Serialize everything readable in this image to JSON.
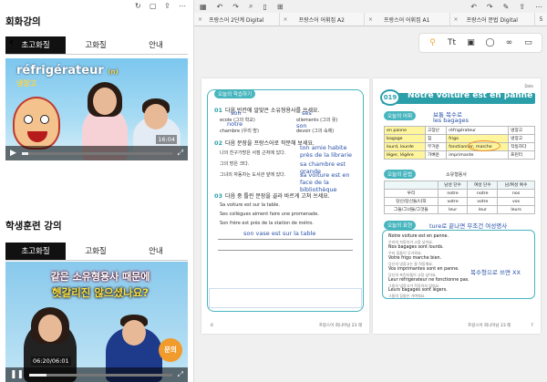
{
  "left": {
    "section1_title": "회화강의",
    "section2_title": "학생훈련 강의",
    "tabs1": [
      "초고화질",
      "고화질",
      "안내"
    ],
    "tabs2": [
      "초고화질",
      "고화질",
      "안내"
    ],
    "video1": {
      "word": "réfrigérateur",
      "word_suffix": "(n)",
      "subtitle": "냉장고",
      "time": "16:04",
      "progress": 0.04
    },
    "video2": {
      "line1": "같은 소유형용사 때문에",
      "line2": "헷갈리진 않으셨나요?",
      "time": "06:20/06:01",
      "progress": 0.12,
      "badge": "문의"
    }
  },
  "right": {
    "doc_tabs": [
      "프랑스어 2단계 Digital",
      "프랑스어 어휘집 A2",
      "프랑스어 어휘집 A1",
      "프랑스어 문법 Digital"
    ],
    "doc_tab_num": "5",
    "left_page": {
      "header_pill": "오늘의 학습하기",
      "q1": "다음 빈칸에 알맞은 소유형용사를 쓰세요.",
      "q1_items": [
        "ecole (그의 학교)",
        "ollements (그의 옷)",
        "chambre (우리 방)",
        "devoir (그의 숙제)"
      ],
      "q1_hand": [
        "son",
        "ses",
        "notre",
        "son"
      ],
      "q2": "다음 문장을 프랑스어로 작문해 보세요.",
      "q2_items": [
        "나의 친구가방은 서점 근처에 있다.",
        "그의 방은 크다.",
        "그녀의 자동차는 도서관 앞에 있다."
      ],
      "q2_hand": [
        "ton amie habite près de la librarie",
        "sa chambre est grande",
        "sa voiture est en face de la bibliothèque"
      ],
      "q3": "다음 중 틀린 문장을 골라 바르게 고쳐 쓰세요.",
      "q3_items": [
        "Sa voiture est sur la table.",
        "Ses collègues aiment faire une promenade.",
        "Son frère est près de la station de métro."
      ],
      "q3_hand": "son vase est sur la table",
      "footer_left": "6",
      "footer_right": "프랑스어 회니어님 23 레"
    },
    "right_page": {
      "date_label": "Date",
      "lesson_num": "019",
      "title": "Notre voiture est en panne",
      "vocab_pill": "오늘의 어휘",
      "vocab_note1": "보통 복수로",
      "vocab_note2": "les bagages",
      "vocab_rows": [
        [
          "en panne",
          "고장난",
          "réfrigérateur",
          "냉장고"
        ],
        [
          "bagage",
          "짐",
          "frigo",
          "냉장고"
        ],
        [
          "lourd, lourde",
          "무거운",
          "fonctionner, marche",
          "작동하다"
        ],
        [
          "léger, légère",
          "가벼운",
          "imprimante",
          "프린터"
        ]
      ],
      "grammar_pill": "오늘의 문법",
      "grammar_sub": "소유형용사",
      "grammar_headers": [
        "",
        "남성 단수",
        "여성 단수",
        "남/여성 복수"
      ],
      "grammar_rows": [
        [
          "우리",
          "notre",
          "notre",
          "nos"
        ],
        [
          "당신/당신들/너희",
          "votre",
          "votre",
          "vos"
        ],
        [
          "그들/그녀들/그것들",
          "leur",
          "leur",
          "leurs"
        ]
      ],
      "expr_pill": "오늘의 표현",
      "expr_note": "ture로 끝나면 무조건 여성명사",
      "expr_lines": [
        [
          "Notre voiture est en panne.",
          "우리의 자동차가 고장 났어요."
        ],
        [
          "Nos bagages sont lourds.",
          "우리 짐들이 무거워요."
        ],
        [
          "Votre frigo marche bien.",
          "당신의 냉장고는 잘 작동해요."
        ],
        [
          "Vos imprimantes sont en panne.",
          "당신의 프린터들이 고장 났어요."
        ],
        [
          "Leur réfrigérateur ne fonctionne pas.",
          "그들의 냉장고가 작동하지 않아요."
        ],
        [
          "Leurs bagages sont légers.",
          "그들의 짐들은 가벼워요."
        ]
      ],
      "expr_hand": "복수형으로 쓰면 XX",
      "footer_left": "프랑스어 회니어님 23 레",
      "footer_right": "7"
    }
  },
  "colors": {
    "teal": "#47b5be",
    "ink": "#2851a8",
    "highlight": "#fff59d",
    "orange": "#f08a24"
  }
}
